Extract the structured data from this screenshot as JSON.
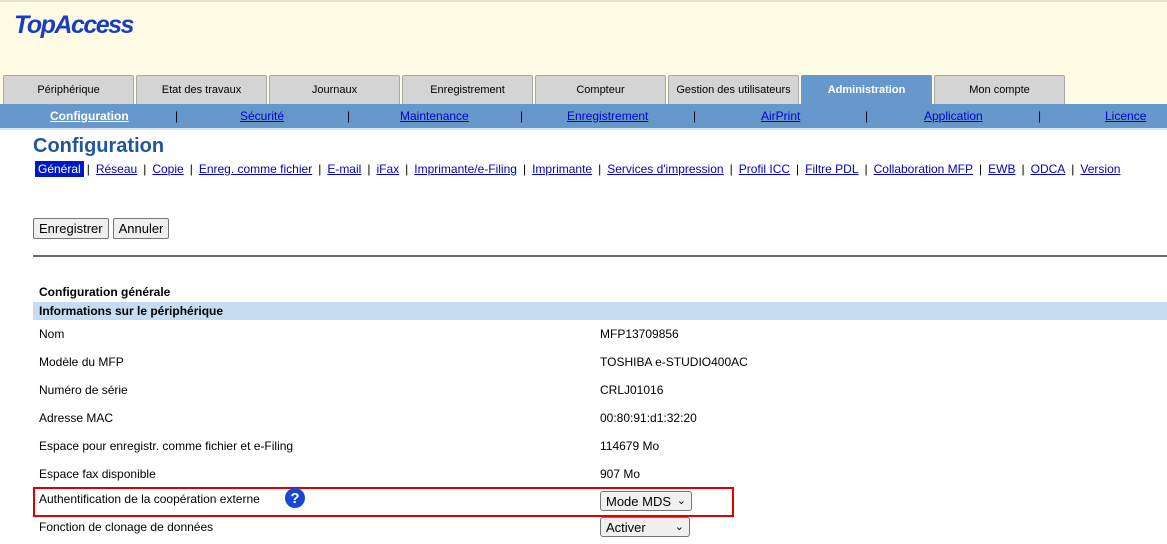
{
  "app": {
    "logo_text": "TopAccess"
  },
  "main_tabs": [
    {
      "label": "Périphérique"
    },
    {
      "label": "Etat des travaux"
    },
    {
      "label": "Journaux"
    },
    {
      "label": "Enregistrement"
    },
    {
      "label": "Compteur"
    },
    {
      "label": "Gestion des utilisateurs"
    },
    {
      "label": "Administration"
    },
    {
      "label": "Mon compte"
    }
  ],
  "active_main_tab": "Administration",
  "subnav": [
    {
      "label": "Configuration"
    },
    {
      "label": "Sécurité"
    },
    {
      "label": "Maintenance"
    },
    {
      "label": "Enregistrement"
    },
    {
      "label": "AirPrint"
    },
    {
      "label": "Application"
    },
    {
      "label": "Licence"
    }
  ],
  "subnav_separator": "|",
  "page": {
    "title": "Configuration",
    "tabs": [
      {
        "label": "Général"
      },
      {
        "label": "Réseau"
      },
      {
        "label": "Copie"
      },
      {
        "label": "Enreg. comme fichier"
      },
      {
        "label": "E-mail"
      },
      {
        "label": "iFax"
      },
      {
        "label": "Imprimante/e-Filing"
      },
      {
        "label": "Imprimante"
      },
      {
        "label": "Services d'impression"
      },
      {
        "label": "Profil ICC"
      },
      {
        "label": "Filtre PDL"
      },
      {
        "label": "Collaboration MFP"
      },
      {
        "label": "EWB"
      },
      {
        "label": "ODCA"
      },
      {
        "label": "Version"
      }
    ],
    "tab_separator": "|",
    "buttons": {
      "save": "Enregistrer",
      "cancel": "Annuler"
    }
  },
  "config": {
    "section_title": "Configuration générale",
    "band_title": "Informations sur le périphérique",
    "rows": [
      {
        "label": "Nom",
        "value": "MFP13709856"
      },
      {
        "label": "Modèle du MFP",
        "value": "TOSHIBA e-STUDIO400AC"
      },
      {
        "label": "Numéro de série",
        "value": "CRLJ01016"
      },
      {
        "label": "Adresse MAC",
        "value": "00:80:91:d1:32:20"
      },
      {
        "label": "Espace pour enregistr. comme fichier et e-Filing",
        "value": "114679 Mo"
      },
      {
        "label": "Espace fax disponible",
        "value": "907 Mo"
      }
    ],
    "external_auth": {
      "label": "Authentification de la coopération externe",
      "value": "Mode MDS",
      "help_glyph": "?"
    },
    "cloning": {
      "label": "Fonction de clonage de données",
      "value": "Activer"
    }
  },
  "icons": {
    "help": "help-icon",
    "dropdown": "chevron-down-icon"
  },
  "colors": {
    "active_tab": "#6798cc",
    "logo": "#1a3cc2",
    "title": "#21569c",
    "highlight": "#e00000",
    "band": "#c6dcf0"
  }
}
